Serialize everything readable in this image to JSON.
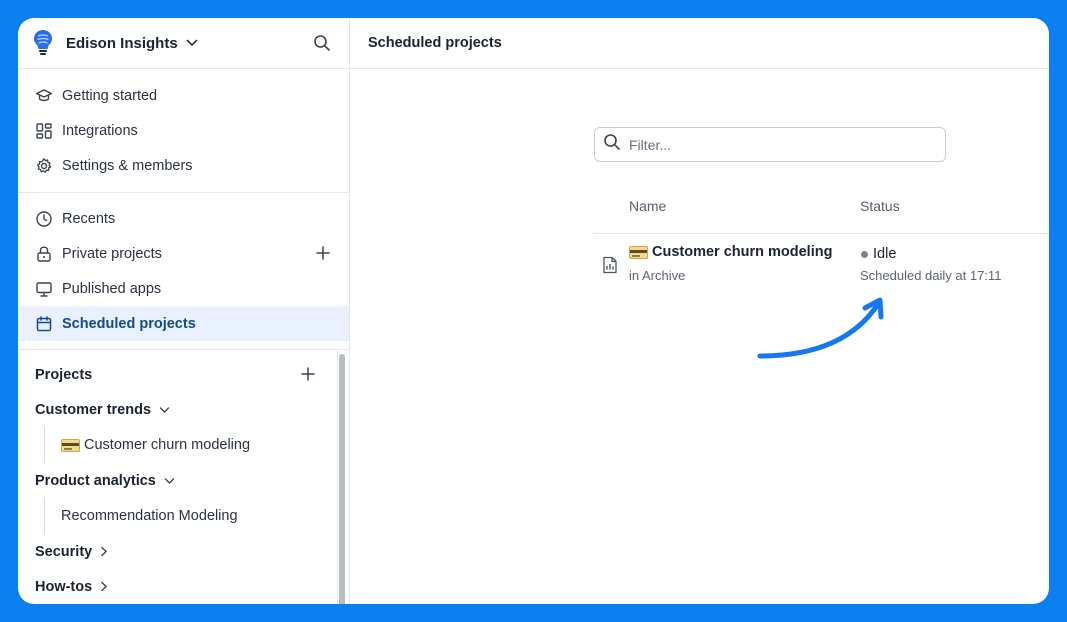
{
  "app": {
    "workspace_name": "Edison Insights",
    "accent": "#0a80f0"
  },
  "sidebar": {
    "top_items": [
      {
        "label": "Getting started",
        "icon": "graduation-cap-icon"
      },
      {
        "label": "Integrations",
        "icon": "dashboard-grid-icon"
      },
      {
        "label": "Settings & members",
        "icon": "gear-icon"
      }
    ],
    "mid_items": [
      {
        "label": "Recents",
        "icon": "clock-icon"
      },
      {
        "label": "Private projects",
        "icon": "lock-icon"
      },
      {
        "label": "Published apps",
        "icon": "monitor-icon"
      },
      {
        "label": "Scheduled projects",
        "icon": "calendar-icon",
        "active": true
      }
    ],
    "projects": {
      "header": "Projects",
      "folders": [
        {
          "label": "Customer trends",
          "expanded": true,
          "children": [
            "Customer churn modeling"
          ]
        },
        {
          "label": "Product analytics",
          "expanded": true,
          "children": [
            "Recommendation Modeling"
          ]
        },
        {
          "label": "Security",
          "expanded": false
        },
        {
          "label": "How-tos",
          "expanded": false
        }
      ]
    }
  },
  "main": {
    "title": "Scheduled projects",
    "filter_placeholder": "Filter...",
    "columns": {
      "name": "Name",
      "status": "Status"
    },
    "rows": [
      {
        "name": "Customer churn modeling",
        "location": "in Archive",
        "status": "Idle",
        "schedule": "Scheduled daily at 17:11",
        "status_color": "#7a8696"
      }
    ]
  }
}
